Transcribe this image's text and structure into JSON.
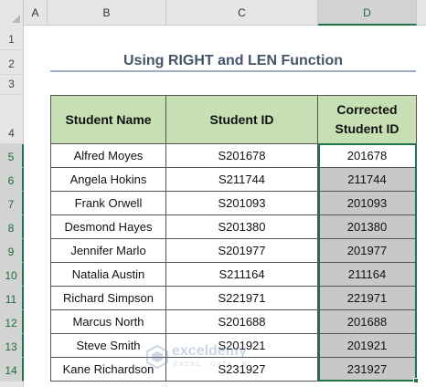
{
  "columns": [
    "A",
    "B",
    "C",
    "D"
  ],
  "rows": [
    "1",
    "2",
    "3",
    "4",
    "5",
    "6",
    "7",
    "8",
    "9",
    "10",
    "11",
    "12",
    "13",
    "14"
  ],
  "title": "Using RIGHT and LEN Function",
  "table": {
    "headers": {
      "name": "Student Name",
      "id": "Student ID",
      "corrected": "Corrected Student ID"
    },
    "records": [
      {
        "name": "Alfred Moyes",
        "id": "S201678",
        "corrected": "201678"
      },
      {
        "name": "Angela Hokins",
        "id": "S211744",
        "corrected": "211744"
      },
      {
        "name": "Frank Orwell",
        "id": "S201093",
        "corrected": "201093"
      },
      {
        "name": "Desmond Hayes",
        "id": "S201380",
        "corrected": "201380"
      },
      {
        "name": "Jennifer Marlo",
        "id": "S201977",
        "corrected": "201977"
      },
      {
        "name": "Natalia Austin",
        "id": "S211164",
        "corrected": "211164"
      },
      {
        "name": "Richard Simpson",
        "id": "S221971",
        "corrected": "221971"
      },
      {
        "name": "Marcus North",
        "id": "S201688",
        "corrected": "201688"
      },
      {
        "name": "Steve Smith",
        "id": "S201921",
        "corrected": "201921"
      },
      {
        "name": "Kane Richardson",
        "id": "S231927",
        "corrected": "231927"
      }
    ]
  },
  "watermark": {
    "name": "exceldemy",
    "tagline": "EXCEL · DATA · BI"
  },
  "colors": {
    "header_fill": "#c6e0b4",
    "selection": "#217346",
    "shaded_cell": "#c8c8c8",
    "title_text": "#44546a"
  }
}
